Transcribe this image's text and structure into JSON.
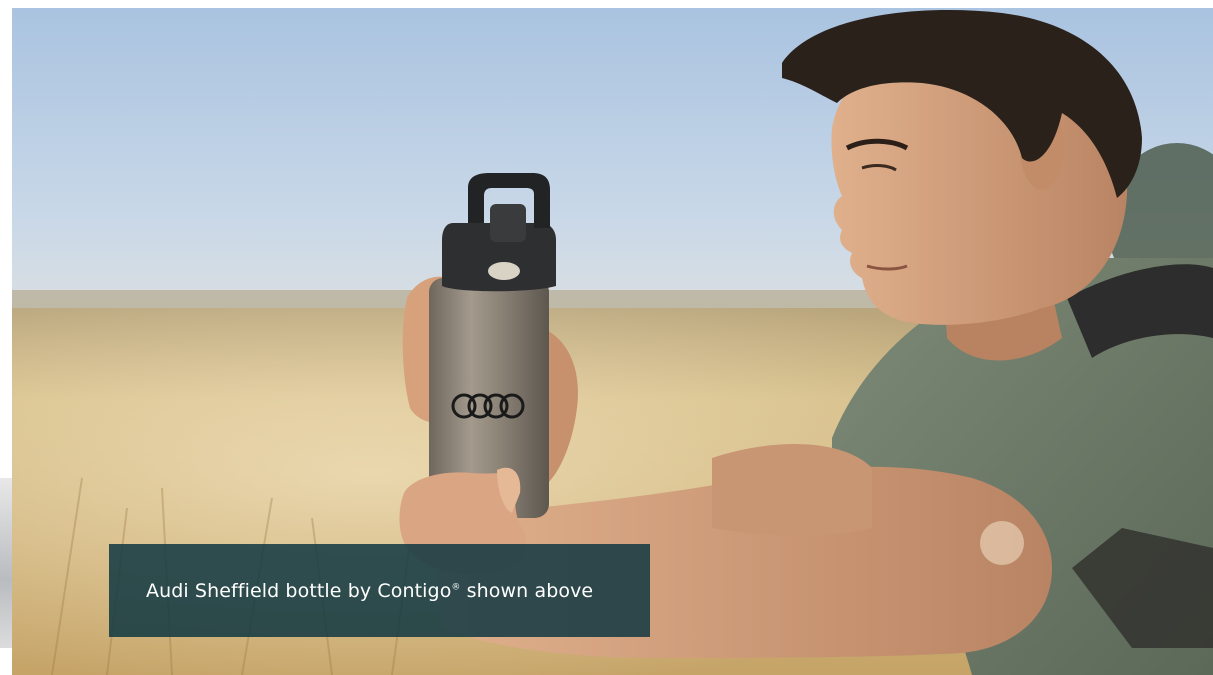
{
  "caption": {
    "text_before": "Audi Sheffield bottle by Contigo",
    "registered_mark": "®",
    "text_after": " shown above"
  },
  "scene": {
    "subject": "man-holding-bottle",
    "bottle_logo": "four-rings-logo",
    "colors": {
      "sky": "#bcd0e6",
      "field": "#cdb27a",
      "shirt": "#6e7c6a",
      "skin": "#c99674",
      "hair": "#2a211b",
      "bottle_steel": "#8c8376",
      "bottle_cap": "#2e2f31",
      "caption_bg": "#123842"
    }
  }
}
